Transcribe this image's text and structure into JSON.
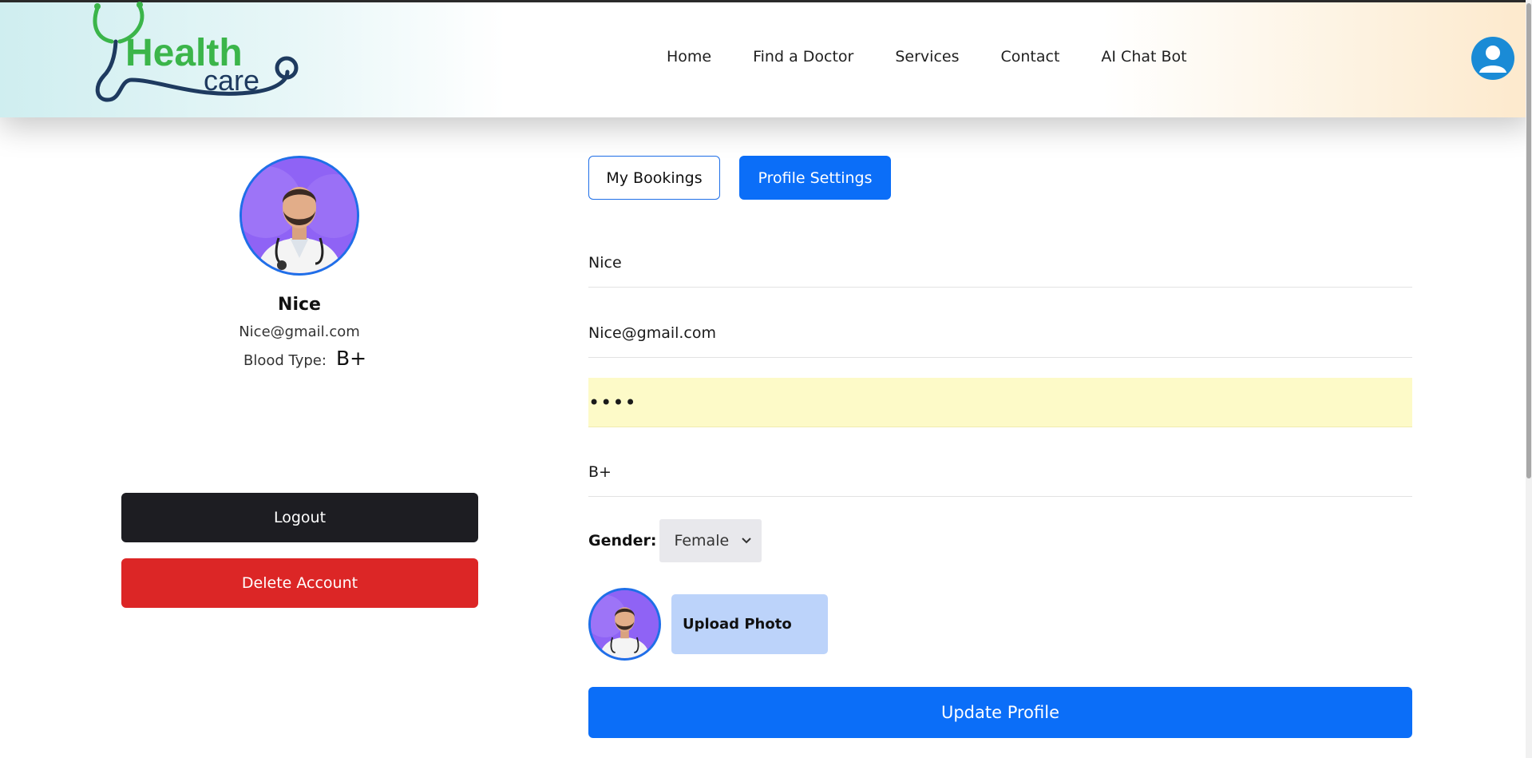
{
  "brand": {
    "logo_word1": "Health",
    "logo_word2": "care",
    "accent": "#3bb54a",
    "navy": "#1e3a5f"
  },
  "nav": {
    "items": [
      "Home",
      "Find a Doctor",
      "Services",
      "Contact",
      "AI Chat Bot"
    ],
    "user_icon": "user-icon"
  },
  "profile": {
    "name": "Nice",
    "email": "Nice@gmail.com",
    "blood_label": "Blood Type:",
    "blood_value": "B+"
  },
  "actions": {
    "logout": "Logout",
    "delete": "Delete Account"
  },
  "tabs": {
    "bookings": "My Bookings",
    "settings": "Profile Settings"
  },
  "form": {
    "name": "Nice",
    "email": "Nice@gmail.com",
    "password": "••••",
    "blood": "B+",
    "gender_label": "Gender:",
    "gender_value": "Female",
    "upload": "Upload Photo",
    "submit": "Update Profile"
  },
  "colors": {
    "primary": "#0b6ef8",
    "danger": "#dc2626",
    "dark": "#1d1d22",
    "upload_bg": "#bcd3fa",
    "autofill": "#fdfac8"
  }
}
